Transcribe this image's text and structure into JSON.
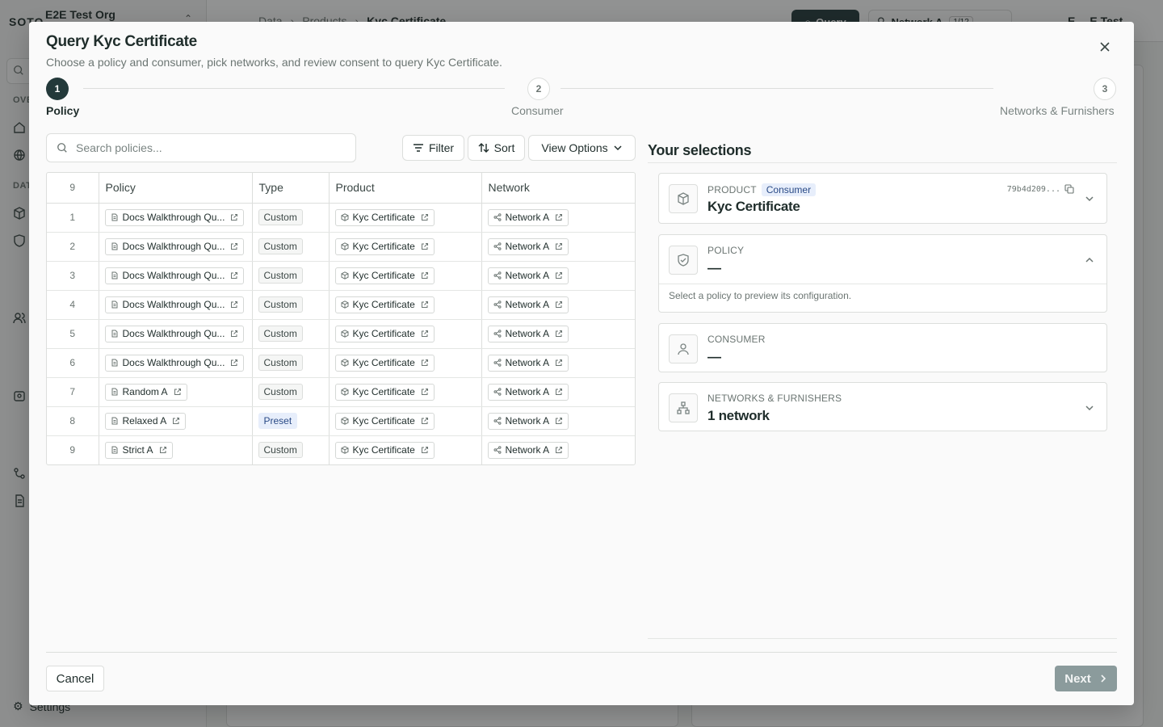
{
  "background": {
    "logo": "SOTO",
    "org_name": "E2E Test Org",
    "sections": [
      "OVE",
      "DAT"
    ],
    "settings_label": "Settings",
    "breadcrumb": [
      "Data",
      "Products",
      "Kyc Certificate"
    ],
    "query_button": "Query",
    "network_selector": "Network A",
    "network_count": "1/12",
    "user_initial": "E",
    "user_name": "E Test"
  },
  "modal": {
    "title": "Query Kyc Certificate",
    "subtitle": "Choose a policy and consumer, pick networks, and review consent to query Kyc Certificate.",
    "steps": [
      {
        "number": "1",
        "label": "Policy"
      },
      {
        "number": "2",
        "label": "Consumer"
      },
      {
        "number": "3",
        "label": "Networks & Furnishers"
      }
    ],
    "active_step": 1
  },
  "toolbar": {
    "search_placeholder": "Search policies...",
    "filter_label": "Filter",
    "sort_label": "Sort",
    "view_options_label": "View Options"
  },
  "table": {
    "row_count": "9",
    "columns": [
      "Policy",
      "Type",
      "Product",
      "Network"
    ],
    "rows": [
      {
        "num": "1",
        "policy": "Docs Walkthrough Qu...",
        "type": "Custom",
        "product": "Kyc Certificate",
        "network": "Network A"
      },
      {
        "num": "2",
        "policy": "Docs Walkthrough Qu...",
        "type": "Custom",
        "product": "Kyc Certificate",
        "network": "Network A"
      },
      {
        "num": "3",
        "policy": "Docs Walkthrough Qu...",
        "type": "Custom",
        "product": "Kyc Certificate",
        "network": "Network A"
      },
      {
        "num": "4",
        "policy": "Docs Walkthrough Qu...",
        "type": "Custom",
        "product": "Kyc Certificate",
        "network": "Network A"
      },
      {
        "num": "5",
        "policy": "Docs Walkthrough Qu...",
        "type": "Custom",
        "product": "Kyc Certificate",
        "network": "Network A"
      },
      {
        "num": "6",
        "policy": "Docs Walkthrough Qu...",
        "type": "Custom",
        "product": "Kyc Certificate",
        "network": "Network A"
      },
      {
        "num": "7",
        "policy": "Random A",
        "type": "Custom",
        "product": "Kyc Certificate",
        "network": "Network A"
      },
      {
        "num": "8",
        "policy": "Relaxed A",
        "type": "Preset",
        "product": "Kyc Certificate",
        "network": "Network A"
      },
      {
        "num": "9",
        "policy": "Strict A",
        "type": "Custom",
        "product": "Kyc Certificate",
        "network": "Network A"
      }
    ]
  },
  "selections": {
    "title": "Your selections",
    "product": {
      "label": "PRODUCT",
      "badge": "Consumer",
      "value": "Kyc Certificate",
      "hash": "79b4d209..."
    },
    "policy": {
      "label": "POLICY",
      "value": "—",
      "hint": "Select a policy to preview its configuration."
    },
    "consumer": {
      "label": "CONSUMER",
      "value": "—"
    },
    "networks": {
      "label": "NETWORKS & FURNISHERS",
      "value": "1 network"
    }
  },
  "footer": {
    "cancel_label": "Cancel",
    "next_label": "Next"
  },
  "colors": {
    "accent": "#23393a",
    "badge_bg": "#e7eefb",
    "badge_text": "#2a4a86",
    "next_disabled": "#8b9b9c"
  }
}
